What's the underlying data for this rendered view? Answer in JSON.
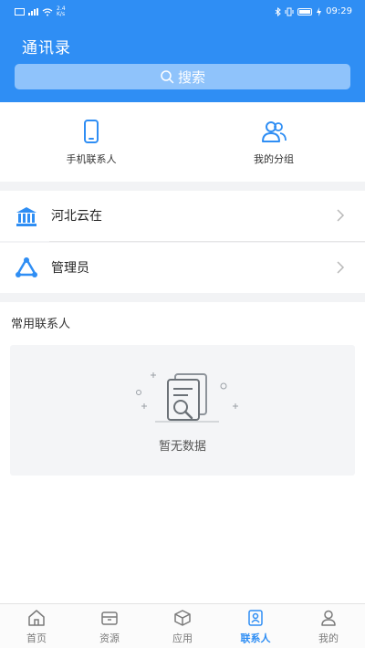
{
  "status_bar": {
    "net_speed_value": "2.4",
    "net_speed_unit": "K/s",
    "time": "09:29"
  },
  "header": {
    "title": "通讯录",
    "search_label": "搜索"
  },
  "quick_entries": [
    {
      "label": "手机联系人",
      "icon": "phone-icon"
    },
    {
      "label": "我的分组",
      "icon": "group-icon"
    }
  ],
  "orgs": [
    {
      "label": "河北云在",
      "icon": "building-icon"
    },
    {
      "label": "管理员",
      "icon": "admin-icon"
    }
  ],
  "frequent": {
    "title": "常用联系人",
    "empty_text": "暂无数据"
  },
  "tabbar": {
    "active": "联系人",
    "tabs": [
      {
        "label": "首页",
        "icon": "home-icon"
      },
      {
        "label": "资源",
        "icon": "resource-icon"
      },
      {
        "label": "应用",
        "icon": "cube-icon"
      },
      {
        "label": "联系人",
        "icon": "contacts-icon"
      },
      {
        "label": "我的",
        "icon": "person-icon"
      }
    ]
  },
  "colors": {
    "primary": "#2f8ef4",
    "search_bg": "#8fc3fb",
    "page_bg": "#f2f3f5"
  }
}
